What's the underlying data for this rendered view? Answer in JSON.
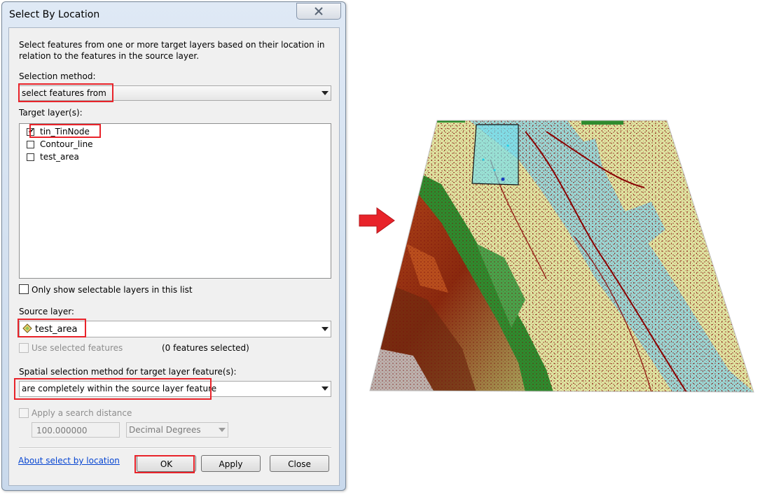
{
  "window": {
    "title": "Select By Location",
    "close_icon": "close-icon"
  },
  "description": "Select features from one or more target layers based on their location in relation to the features in the source layer.",
  "selection_method": {
    "label": "Selection method:",
    "value": "select features from"
  },
  "target_layers": {
    "label": "Target layer(s):",
    "items": [
      {
        "label": "tin_TinNode",
        "checked": true
      },
      {
        "label": "Contour_line",
        "checked": false
      },
      {
        "label": "test_area",
        "checked": false
      }
    ]
  },
  "only_selectable": {
    "label": "Only show selectable layers in this list",
    "checked": false
  },
  "source_layer": {
    "label": "Source layer:",
    "value": "test_area",
    "icon": "polygon-layer-icon"
  },
  "use_selected": {
    "label": "Use selected features",
    "count_text": "(0 features selected)",
    "checked": false,
    "enabled": false
  },
  "spatial_method": {
    "label": "Spatial selection method for target layer feature(s):",
    "value": "are completely within the source layer feature"
  },
  "search_distance": {
    "label": "Apply a search distance",
    "checked": false,
    "enabled": false,
    "value": "100.000000",
    "units": "Decimal Degrees"
  },
  "footer": {
    "help_link": "About select by location",
    "ok": "OK",
    "apply": "Apply",
    "close": "Close"
  },
  "colors": {
    "highlight_red": "#e8232a",
    "link_blue": "#0645d2",
    "water_cyan": "#9bd6d3",
    "flat_land": "#dfe3a0",
    "forest_green": "#2e8b2e",
    "terrain_brown": "#8b2a10",
    "contour_red": "#8b0000"
  }
}
